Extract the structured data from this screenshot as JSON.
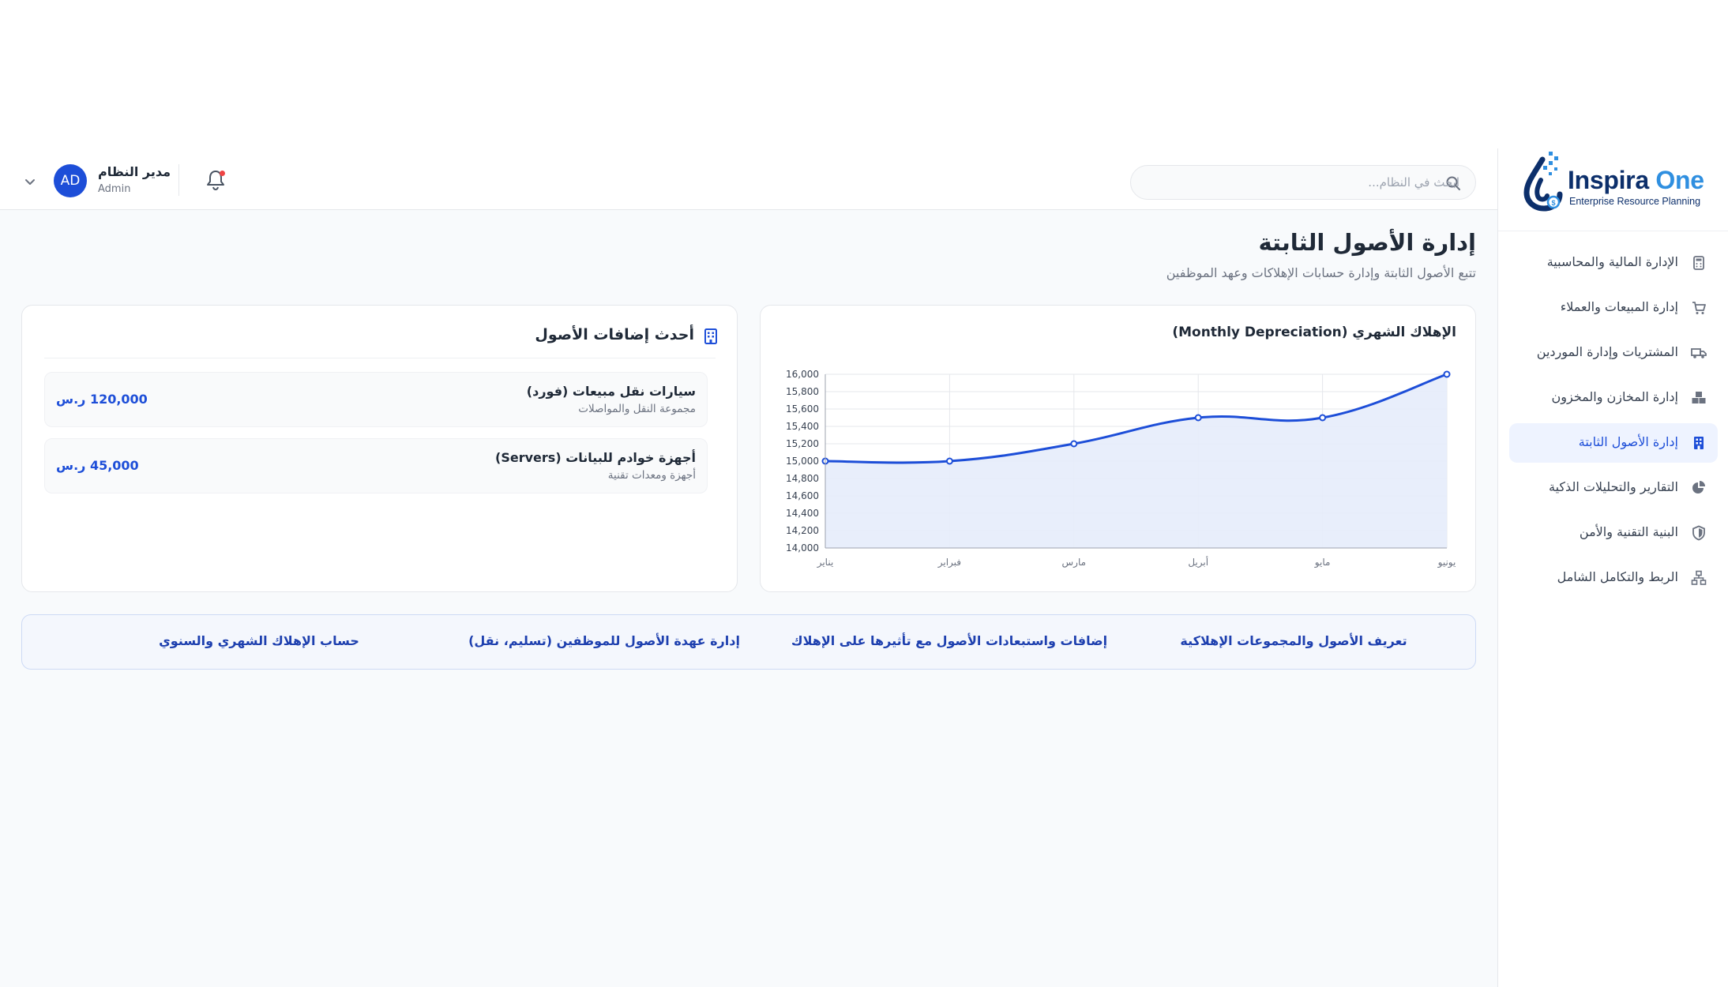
{
  "brand": {
    "name_main": "Inspira",
    "name_accent": "One",
    "tagline": "Enterprise Resource Planning"
  },
  "sidebar": {
    "items": [
      {
        "label": "الإدارة المالية والمحاسبية",
        "icon": "calculator-icon",
        "active": false
      },
      {
        "label": "إدارة المبيعات والعملاء",
        "icon": "cart-icon",
        "active": false
      },
      {
        "label": "المشتريات وإدارة الموردين",
        "icon": "truck-icon",
        "active": false
      },
      {
        "label": "إدارة المخازن والمخزون",
        "icon": "boxes-icon",
        "active": false
      },
      {
        "label": "إدارة الأصول الثابتة",
        "icon": "building-icon",
        "active": true
      },
      {
        "label": "التقارير والتحليلات الذكية",
        "icon": "pie-chart-icon",
        "active": false
      },
      {
        "label": "البنية التقنية والأمن",
        "icon": "shield-icon",
        "active": false
      },
      {
        "label": "الربط والتكامل الشامل",
        "icon": "network-icon",
        "active": false
      }
    ]
  },
  "header": {
    "search_placeholder": "ابحث في النظام...",
    "user": {
      "initials": "AD",
      "name": "مدير النظام",
      "role": "Admin"
    }
  },
  "page": {
    "title": "إدارة الأصول الثابتة",
    "subtitle": "تتبع الأصول الثابتة وإدارة حسابات الإهلاكات وعهد الموظفين"
  },
  "chart_card": {
    "title": "الإهلاك الشهري (Monthly Depreciation)"
  },
  "chart_data": {
    "type": "area",
    "categories": [
      "يناير",
      "فبراير",
      "مارس",
      "أبريل",
      "مايو",
      "يونيو"
    ],
    "series": [
      {
        "values": [
          15000,
          15000,
          15200,
          15500,
          15500,
          16000
        ]
      }
    ],
    "y_ticks": [
      "16,000",
      "15,800",
      "15,600",
      "15,400",
      "15,200",
      "15,000",
      "14,800",
      "14,600",
      "14,400",
      "14,200",
      "14,000"
    ],
    "ylim": [
      14000,
      16000
    ],
    "grid": true,
    "line_color": "#1d4ed8",
    "fill_color": "#e6ecfb"
  },
  "assets_card": {
    "title": "أحدث إضافات الأصول",
    "items": [
      {
        "name": "سيارات نقل مبيعات (فورد)",
        "category": "مجموعة النقل والمواصلات",
        "value": "120,000 ر.س"
      },
      {
        "name": "أجهزة خوادم للبيانات (Servers)",
        "category": "أجهزة ومعدات تقنية",
        "value": "45,000 ر.س"
      }
    ]
  },
  "quick_links": [
    "تعريف الأصول والمجموعات الإهلاكية",
    "إضافات واستبعادات الأصول مع تأثيرها على الإهلاك",
    "إدارة عهدة الأصول للموظفين (تسليم، نقل)",
    "حساب الإهلاك الشهري والسنوي"
  ],
  "colors": {
    "accent": "#1d4ed8",
    "active_bg": "#eef3ff",
    "notification_dot": "#ef4444",
    "brand_dark": "#0c2f6b",
    "brand_light": "#2f8fe0"
  }
}
